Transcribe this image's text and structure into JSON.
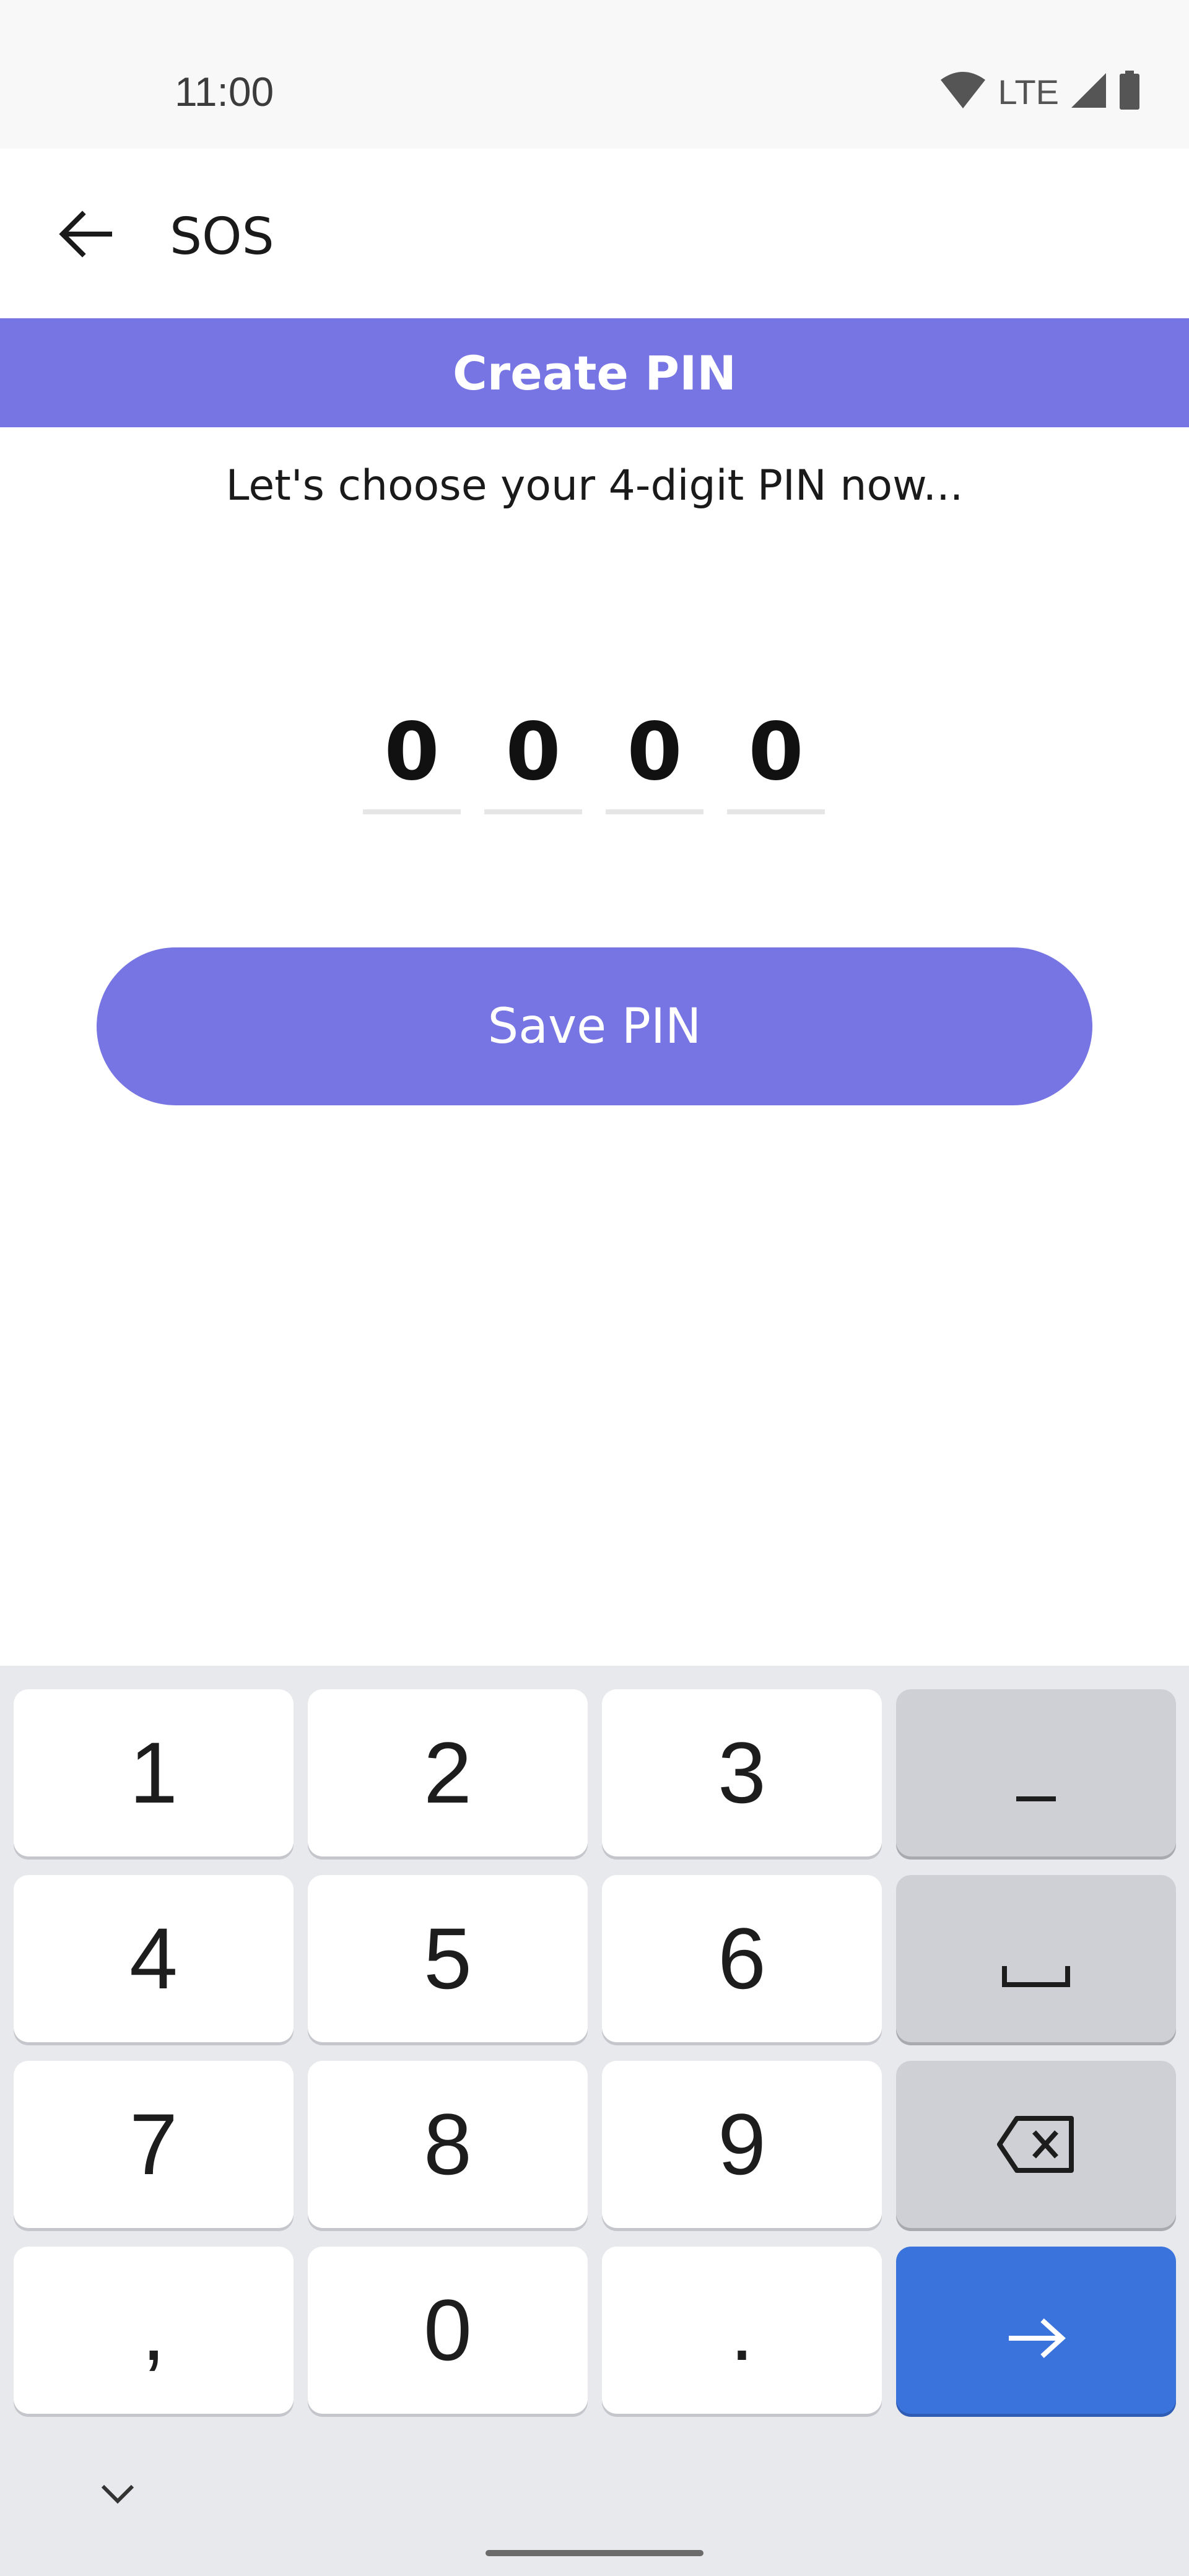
{
  "status_bar": {
    "time": "11:00",
    "network": "LTE"
  },
  "app_bar": {
    "title": "SOS"
  },
  "header": {
    "title": "Create PIN"
  },
  "subtitle": "Let's choose your 4-digit PIN now...",
  "pin": {
    "digits": [
      "0",
      "0",
      "0",
      "0"
    ]
  },
  "save_button": {
    "label": "Save PIN"
  },
  "keyboard": {
    "keys": [
      "1",
      "2",
      "3",
      "4",
      "5",
      "6",
      "7",
      "8",
      "9",
      ",",
      "0",
      "."
    ],
    "icons": [
      "minus-icon",
      "space-icon",
      "backspace-icon",
      "arrow-right-icon",
      "chevron-down-icon"
    ],
    "accent_color": "#3b73dd"
  },
  "colors": {
    "brand": "#7775e3",
    "keyboard_bg": "#e8e9ed"
  }
}
